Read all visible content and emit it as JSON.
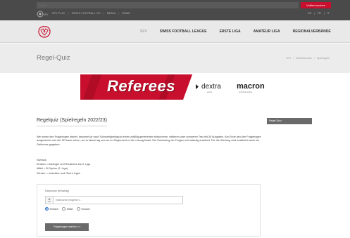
{
  "topbar": {
    "search_placeholder": "Suche",
    "search_button": "Volltext suchen",
    "metanav": [
      "SFV PLAY",
      "SWISS FOOTBALL OH",
      "MEDIA",
      "HOME"
    ],
    "langs": [
      "DE",
      "FR",
      "IT"
    ]
  },
  "nav": {
    "items": [
      "SFV",
      "SWISS FOOTBALL LEAGUE",
      "ERSTE LIGA",
      "AMATEUR LIGA",
      "REGIONALVERBÄNDE"
    ]
  },
  "titleband": {
    "title": "Regel-Quiz",
    "crumbs": [
      "SFV",
      "Schiedsrichter",
      "Spielregeln"
    ]
  },
  "banner": {
    "word": "Referees",
    "sponsor1": "dextra",
    "sponsor1_sub": "sports",
    "sponsor2": "macron",
    "sponsor2_sub": "technical partner"
  },
  "content": {
    "heading": "Regelquiz (Spielregeln 2022/23)",
    "intro": "Wer einen den Fragebogen startet, bekommt je nach Schwierigkeitsgrad einen zufällig generierten einfacheren, mittleren oder schweren Test mit 30 Aufgaben. Am Ende wird der Fragebogen ausgewertet und der SR kann sehen, wo er falsch lag und wo im Reglement er die Lösung findet. Die Sammlung der Fragen wird ständig erweitert. Für die Wertung wird zusätzlich auch ein Zeitbonus gegeben.",
    "levels_title": "Niveaus",
    "levels": [
      "Einfach = Anfänger und Routiniers bis 3. Liga",
      "Mittel = B-Diplom (2. Liga)",
      "Schwer = Instruktor und Obere Ligen"
    ]
  },
  "form": {
    "label": "Nickname (freiwillig)",
    "nickname_placeholder": "Nickname eingeben...",
    "options": [
      "Einfach",
      "Mittel",
      "Schwer"
    ],
    "selected": "Einfach",
    "submit": "Fragebogen starten >>"
  },
  "sidebar": {
    "item": "Regel-Quiz"
  },
  "colors": {
    "brand_red": "#c8102e",
    "topbar": "#4a4a4a",
    "button_grey": "#6a6a6a"
  }
}
